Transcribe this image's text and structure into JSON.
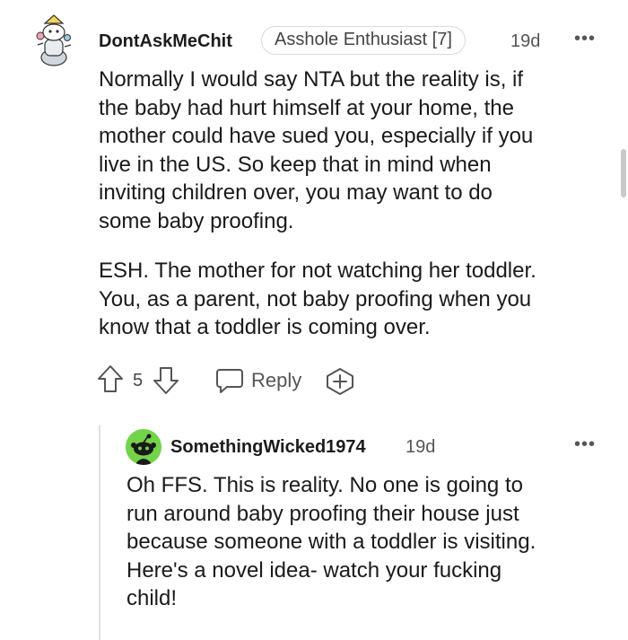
{
  "comment": {
    "username": "DontAskMeChit",
    "flair": "Asshole Enthusiast [7]",
    "time": "19d",
    "more_icon": "•••",
    "paragraphs": [
      "Normally I would say NTA but the reality is, if\nthe baby had hurt himself at your home, the\nmother could have sued you, especially if you\nlive in the US. So keep that in mind when\ninviting children over, you may want to do\nsome baby proofing.",
      "ESH. The mother for not watching her toddler.\nYou, as a parent, not baby proofing when you\nknow that a toddler is coming over."
    ],
    "vote_count": "5",
    "reply_label": "Reply"
  },
  "reply": {
    "username": "SomethingWicked1974",
    "time": "19d",
    "more_icon": "•••",
    "paragraph": "Oh FFS. This is reality. No one is going to\nrun around baby proofing their house just\nbecause someone with a toddler is visiting.\nHere's a novel idea- watch your fucking\nchild!"
  },
  "colors": {
    "text": "#1a1a1b",
    "meta": "#555555",
    "avatar_green": "#73d34b",
    "thread_line": "#e0e0e0"
  }
}
